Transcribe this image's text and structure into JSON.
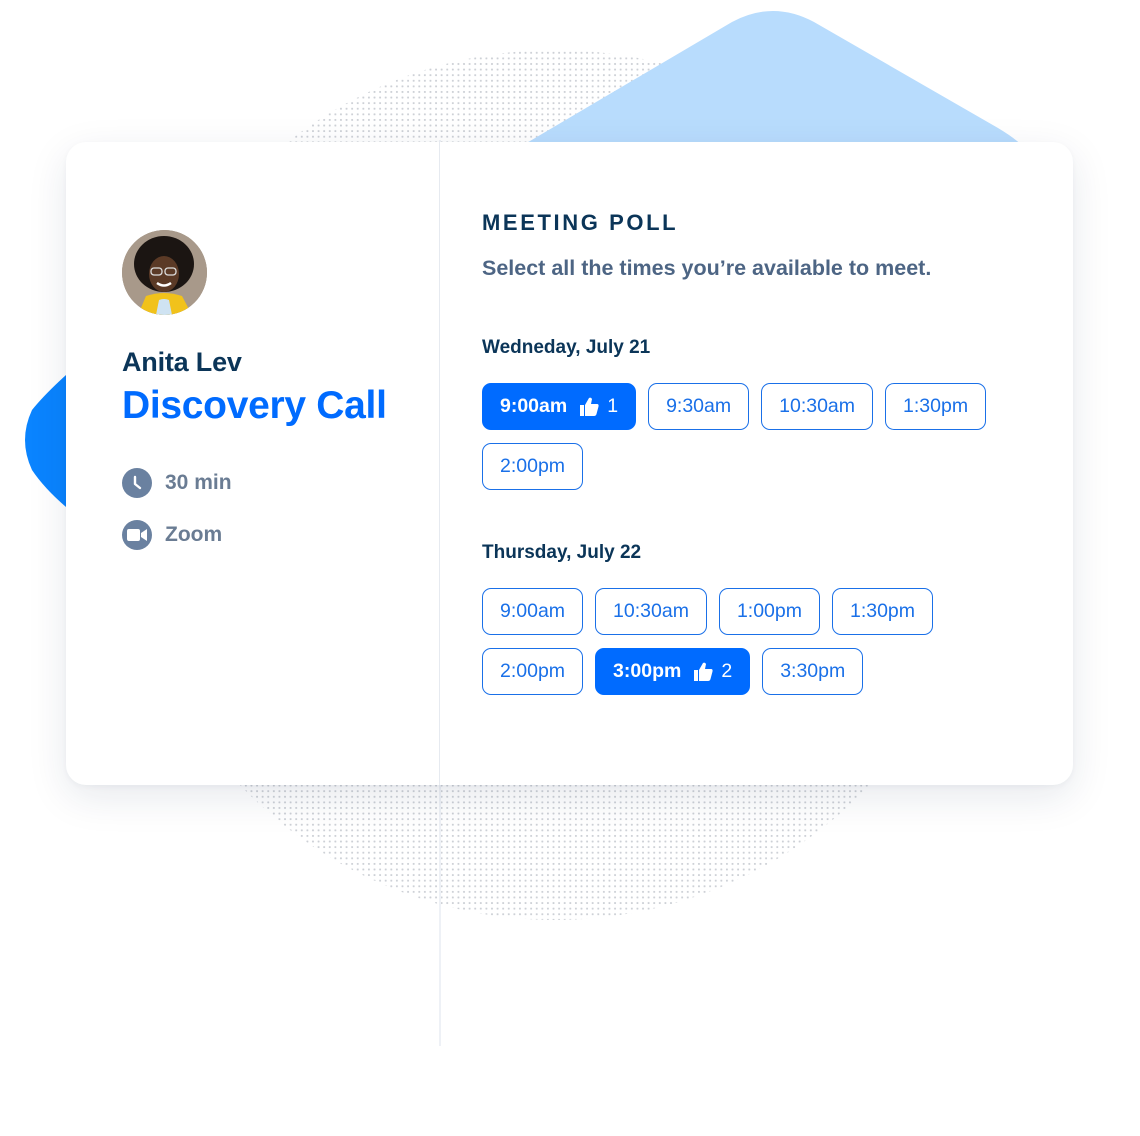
{
  "colors": {
    "brand_blue": "#006bff",
    "navy": "#0b3558",
    "slate": "#4d6584",
    "light_blue_shape": "#b8dcfd"
  },
  "host": {
    "name": "Anita Lev",
    "avatar_alt": "host avatar photo"
  },
  "event": {
    "title": "Discovery Call",
    "duration": "30 min",
    "location": "Zoom",
    "duration_icon": "clock-icon",
    "location_icon": "video-camera-icon"
  },
  "poll": {
    "title": "MEETING POLL",
    "subtitle": "Select all the times you’re available to meet.",
    "days": [
      {
        "label": "Wedneday, July 21",
        "slots": [
          {
            "time": "9:00am",
            "selected": true,
            "votes": "1"
          },
          {
            "time": "9:30am",
            "selected": false
          },
          {
            "time": "10:30am",
            "selected": false
          },
          {
            "time": "1:30pm",
            "selected": false
          },
          {
            "time": "2:00pm",
            "selected": false
          }
        ]
      },
      {
        "label": "Thursday, July 22",
        "slots": [
          {
            "time": "9:00am",
            "selected": false
          },
          {
            "time": "10:30am",
            "selected": false
          },
          {
            "time": "1:00pm",
            "selected": false
          },
          {
            "time": "1:30pm",
            "selected": false
          },
          {
            "time": "2:00pm",
            "selected": false
          },
          {
            "time": "3:00pm",
            "selected": true,
            "votes": "2"
          },
          {
            "time": "3:30pm",
            "selected": false
          }
        ]
      }
    ]
  }
}
